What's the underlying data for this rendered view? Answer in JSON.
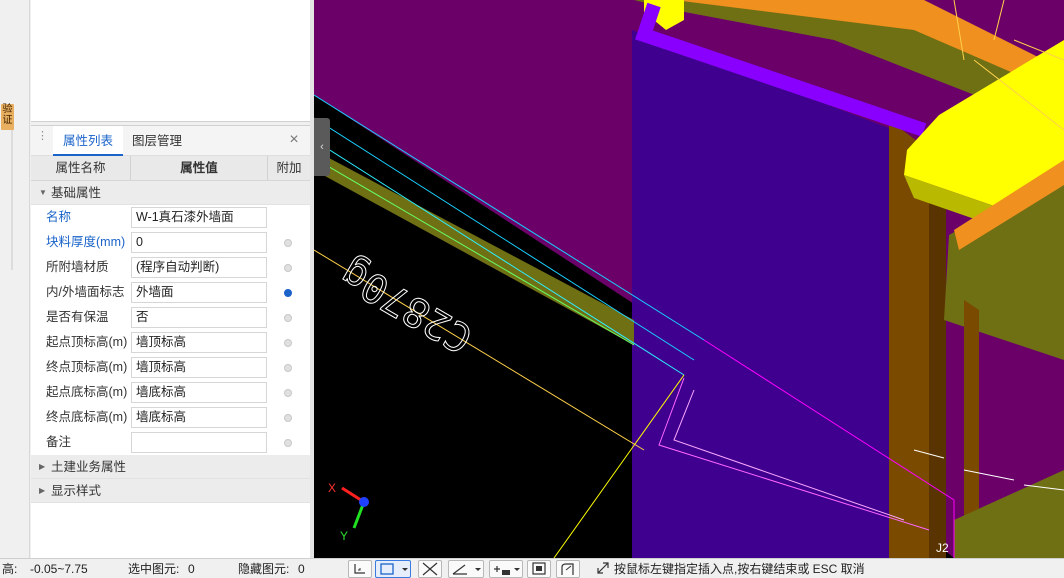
{
  "left_strip": {
    "tag": "验\n证"
  },
  "panel": {
    "tabs": [
      {
        "label": "属性列表",
        "active": true
      },
      {
        "label": "图层管理",
        "active": false
      }
    ],
    "close_glyph": "×",
    "columns": {
      "name": "属性名称",
      "value": "属性值",
      "extra": "附加"
    },
    "basic_group": "基础属性",
    "rows": [
      {
        "name": "名称",
        "value": "W-1真石漆外墙面",
        "blue": true,
        "dot": "none"
      },
      {
        "name": "块料厚度(mm)",
        "value": "0",
        "blue": true,
        "dot": "off"
      },
      {
        "name": "所附墙材质",
        "value": "(程序自动判断)",
        "blue": false,
        "dot": "off"
      },
      {
        "name": "内/外墙面标志",
        "value": "外墙面",
        "blue": false,
        "dot": "on"
      },
      {
        "name": "是否有保温",
        "value": "否",
        "blue": false,
        "dot": "off"
      },
      {
        "name": "起点顶标高(m)",
        "value": "墙顶标高",
        "blue": false,
        "dot": "off"
      },
      {
        "name": "终点顶标高(m)",
        "value": "墙顶标高",
        "blue": false,
        "dot": "off"
      },
      {
        "name": "起点底标高(m)",
        "value": "墙底标高",
        "blue": false,
        "dot": "off"
      },
      {
        "name": "终点底标高(m)",
        "value": "墙底标高",
        "blue": false,
        "dot": "off"
      },
      {
        "name": "备注",
        "value": "",
        "blue": false,
        "dot": "off"
      }
    ],
    "groups_collapsed": [
      "土建业务属性",
      "显示样式"
    ]
  },
  "viewport": {
    "label_text": "C2870g",
    "axis_x": "X",
    "axis_y": "Y",
    "corner_label": "J2",
    "colors": {
      "background": "#000000",
      "magenta": "#6a0068",
      "wall_blue": "#3f0090",
      "violet": "#8a00ff",
      "yellow": "#ffff00",
      "orange": "#f0901e",
      "olive": "#6f6f14",
      "brown": "#7a4a00"
    }
  },
  "statusbar": {
    "height_label": "高:",
    "height_value": "-0.05~7.75",
    "selected_label": "选中图元:",
    "selected_value": "0",
    "hidden_label": "隐藏图元:",
    "hidden_value": "0",
    "hint": "按鼠标左键指定插入点,按右键结束或 ESC 取消"
  }
}
